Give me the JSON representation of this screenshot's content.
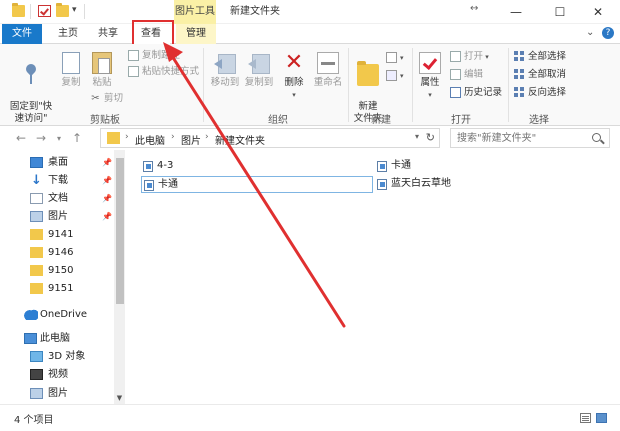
{
  "window": {
    "title": "新建文件夹",
    "context_tab_label": "图片工具",
    "move_glyph": "↔",
    "controls": {
      "minimize": "—",
      "maximize": "☐",
      "close": "✕"
    },
    "quick_access_caret": "▾"
  },
  "tabs": {
    "file": "文件",
    "home": "主页",
    "share": "共享",
    "view": "查看",
    "manage": "管理",
    "collapse": "⌄",
    "help": "?"
  },
  "ribbon": {
    "clipboard": {
      "label": "剪贴板",
      "pin": "固定到\"快\n速访问\"",
      "copy": "复制",
      "paste": "粘贴",
      "copy_path": "复制路径",
      "paste_shortcut": "粘贴快捷方式",
      "cut": "剪切"
    },
    "organize": {
      "label": "组织",
      "move_to": "移动到",
      "copy_to": "复制到",
      "delete": "删除",
      "rename": "重命名"
    },
    "new": {
      "label": "新建",
      "new_folder": "新建\n文件夹"
    },
    "open": {
      "label": "打开",
      "properties": "属性",
      "open": "打开",
      "edit": "编辑",
      "history": "历史记录"
    },
    "select": {
      "label": "选择",
      "select_all": "全部选择",
      "select_none": "全部取消",
      "invert": "反向选择"
    }
  },
  "address": {
    "crumbs": [
      "此电脑",
      "图片",
      "新建文件夹"
    ],
    "separator": "›",
    "search_placeholder": "搜索\"新建文件夹\""
  },
  "nav": {
    "items": [
      {
        "label": "桌面",
        "pinned": true
      },
      {
        "label": "下载",
        "pinned": true
      },
      {
        "label": "文档",
        "pinned": true
      },
      {
        "label": "图片",
        "pinned": true
      },
      {
        "label": "9141"
      },
      {
        "label": "9146"
      },
      {
        "label": "9150"
      },
      {
        "label": "9151"
      },
      {
        "label": "OneDrive"
      },
      {
        "label": "此电脑"
      },
      {
        "label": "3D 对象"
      },
      {
        "label": "视频"
      },
      {
        "label": "图片"
      }
    ]
  },
  "files": [
    {
      "name": "4-3"
    },
    {
      "name": "卡通"
    },
    {
      "name": "卡通"
    },
    {
      "name": "蓝天白云草地"
    }
  ],
  "status": {
    "count": "4 个项目"
  },
  "colors": {
    "accent": "#1979ca",
    "annotation": "#e03030",
    "context_tab": "#faf0a6"
  }
}
